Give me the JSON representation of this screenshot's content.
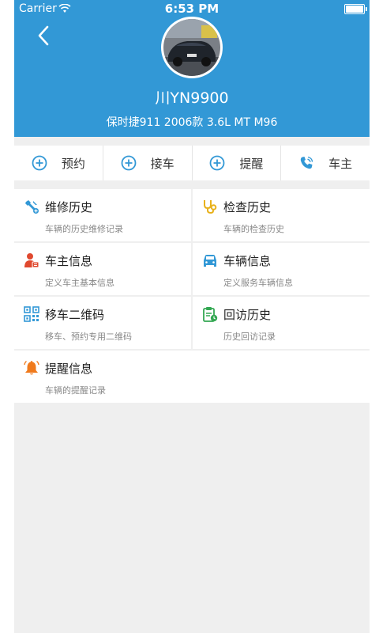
{
  "status_bar": {
    "carrier": "Carrier",
    "time": "6:53 PM"
  },
  "header": {
    "plate": "川YN9900",
    "model": "保时捷911 2006款 3.6L MT M96",
    "back_icon": "chevron-left-icon"
  },
  "actions": [
    {
      "label": "预约",
      "icon": "plus-circle-icon"
    },
    {
      "label": "接车",
      "icon": "plus-circle-icon"
    },
    {
      "label": "提醒",
      "icon": "plus-circle-icon"
    },
    {
      "label": "车主",
      "icon": "phone-icon"
    }
  ],
  "menu": [
    {
      "title": "维修历史",
      "subtitle": "车辆的历史维修记录",
      "icon": "wrench-icon",
      "color": "#3298d6"
    },
    {
      "title": "检查历史",
      "subtitle": "车辆的检查历史",
      "icon": "stethoscope-icon",
      "color": "#e8b11b"
    },
    {
      "title": "车主信息",
      "subtitle": "定义车主基本信息",
      "icon": "person-card-icon",
      "color": "#e0492f"
    },
    {
      "title": "车辆信息",
      "subtitle": "定义服务车辆信息",
      "icon": "car-icon",
      "color": "#3298d6"
    },
    {
      "title": "移车二维码",
      "subtitle": "移车、预约专用二维码",
      "icon": "qrcode-icon",
      "color": "#3298d6"
    },
    {
      "title": "回访历史",
      "subtitle": "历史回访记录",
      "icon": "clipboard-icon",
      "color": "#34a853"
    },
    {
      "title": "提醒信息",
      "subtitle": "车辆的提醒记录",
      "icon": "bell-icon",
      "color": "#f07a1c"
    }
  ],
  "colors": {
    "brand": "#3298d6",
    "background": "#efefef"
  }
}
